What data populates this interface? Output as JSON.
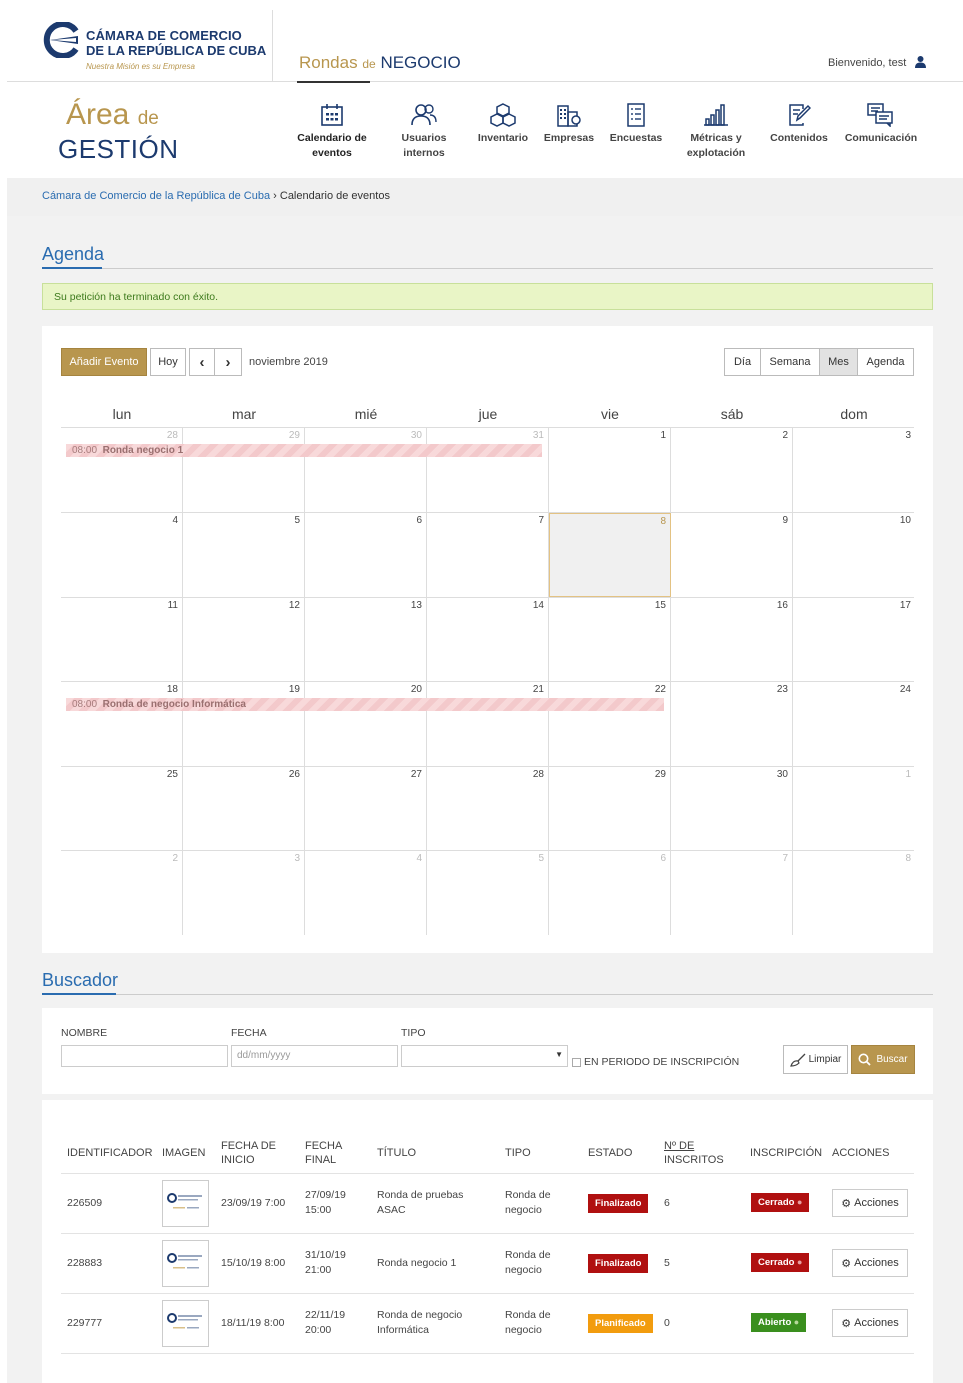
{
  "header": {
    "logo_line1": "CÁMARA DE COMERCIO",
    "logo_line2": "DE LA REPÚBLICA DE CUBA",
    "logo_tagline": "Nuestra Misión es su Empresa",
    "rondas": "Rondas",
    "rondas_de": "de",
    "rondas_negocio": "NEGOCIO",
    "welcome": "Bienvenido, test"
  },
  "area": {
    "word1": "Área",
    "word2": "de",
    "word3": "GESTIÓN"
  },
  "nav": [
    {
      "label1": "Calendario de",
      "label2": "eventos",
      "icon": "calendar-icon"
    },
    {
      "label1": "Usuarios",
      "label2": "internos",
      "icon": "users-icon"
    },
    {
      "label1": "Inventario",
      "label2": "",
      "icon": "boxes-icon"
    },
    {
      "label1": "Empresas",
      "label2": "",
      "icon": "buildings-icon"
    },
    {
      "label1": "Encuestas",
      "label2": "",
      "icon": "survey-icon"
    },
    {
      "label1": "Métricas y",
      "label2": "explotación",
      "icon": "bar-chart-icon"
    },
    {
      "label1": "Contenidos",
      "label2": "",
      "icon": "edit-icon"
    },
    {
      "label1": "Comunicación",
      "label2": "",
      "icon": "chat-icon"
    }
  ],
  "breadcrumb": {
    "home": "Cámara de Comercio de la República de Cuba",
    "sep": "›",
    "current": "Calendario de eventos"
  },
  "agenda": {
    "title": "Agenda",
    "alert": "Su petición ha terminado con éxito."
  },
  "calendar": {
    "add_event": "Añadir Evento",
    "today": "Hoy",
    "prev": "‹",
    "next": "›",
    "month": "noviembre 2019",
    "views": [
      "Día",
      "Semana",
      "Mes",
      "Agenda"
    ],
    "active_view": "Mes",
    "weekdays": [
      "lun",
      "mar",
      "mié",
      "jue",
      "vie",
      "sáb",
      "dom"
    ],
    "weeks": [
      [
        "28",
        "29",
        "30",
        "31",
        "1",
        "2",
        "3"
      ],
      [
        "4",
        "5",
        "6",
        "7",
        "8",
        "9",
        "10"
      ],
      [
        "11",
        "12",
        "13",
        "14",
        "15",
        "16",
        "17"
      ],
      [
        "18",
        "19",
        "20",
        "21",
        "22",
        "23",
        "24"
      ],
      [
        "25",
        "26",
        "27",
        "28",
        "29",
        "30",
        "1"
      ],
      [
        "2",
        "3",
        "4",
        "5",
        "6",
        "7",
        "8"
      ]
    ],
    "events": [
      {
        "time": "08:00",
        "title": "Ronda negocio 1"
      },
      {
        "time": "08:00",
        "title": "Ronda de negocio Informática"
      }
    ]
  },
  "buscador": {
    "title": "Buscador",
    "nombre_label": "NOMBRE",
    "fecha_label": "FECHA",
    "fecha_placeholder": "dd/mm/yyyy",
    "tipo_label": "TIPO",
    "periodo_label": "EN PERIODO DE INSCRIPCIÓN",
    "limpiar": "Limpiar",
    "buscar": "Buscar"
  },
  "table": {
    "headers": {
      "id": "IDENTIFICADOR",
      "imagen": "IMAGEN",
      "inicio1": "FECHA DE",
      "inicio2": "INICIO",
      "final1": "FECHA",
      "final2": "FINAL",
      "titulo": "TÍTULO",
      "tipo": "TIPO",
      "estado": "ESTADO",
      "inscritos1": "Nº DE",
      "inscritos2": "INSCRITOS",
      "inscripcion": "INSCRIPCIÓN",
      "acciones": "ACCIONES"
    },
    "rows": [
      {
        "id": "226509",
        "inicio": "23/09/19 7:00",
        "final1": "27/09/19",
        "final2": "15:00",
        "titulo1": "Ronda de pruebas",
        "titulo2": "ASAC",
        "tipo1": "Ronda de",
        "tipo2": "negocio",
        "estado": "Finalizado",
        "inscritos": "6",
        "inscripcion": "Cerrado",
        "acciones": "Acciones"
      },
      {
        "id": "228883",
        "inicio": "15/10/19 8:00",
        "final1": "31/10/19",
        "final2": "21:00",
        "titulo1": "Ronda negocio 1",
        "titulo2": "",
        "tipo1": "Ronda de",
        "tipo2": "negocio",
        "estado": "Finalizado",
        "inscritos": "5",
        "inscripcion": "Cerrado",
        "acciones": "Acciones"
      },
      {
        "id": "229777",
        "inicio": "18/11/19 8:00",
        "final1": "22/11/19",
        "final2": "20:00",
        "titulo1": "Ronda de negocio",
        "titulo2": "Informática",
        "tipo1": "Ronda de",
        "tipo2": "negocio",
        "estado": "Planificado",
        "inscritos": "0",
        "inscripcion": "Abierto",
        "acciones": "Acciones"
      }
    ]
  },
  "colors": {
    "gold": "#b8964e",
    "navy": "#1c3a6e",
    "blue": "#2a6cb0",
    "red": "#b01010",
    "orange": "#f29c0e",
    "green": "#3a8f1e"
  }
}
